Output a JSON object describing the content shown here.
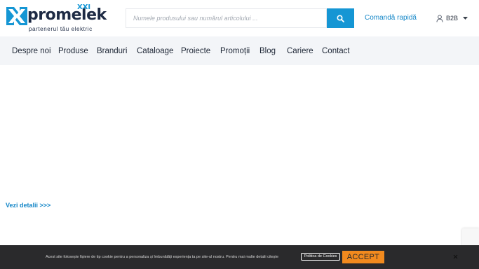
{
  "logo": {
    "name": "promelek",
    "suffix": "XXI",
    "tagline": "partenerul tău elektric"
  },
  "search": {
    "placeholder": "Numele produsului sau numărul articolului ..."
  },
  "header": {
    "quick_order": "Comandă rapidă",
    "b2b": "B2B"
  },
  "nav": {
    "items": [
      {
        "label": "Despre noi"
      },
      {
        "label": "Produse"
      },
      {
        "label": "Branduri"
      },
      {
        "label": "Cataloage"
      },
      {
        "label": "Proiecte"
      },
      {
        "label": "Promoții"
      },
      {
        "label": "Blog"
      },
      {
        "label": "Cariere"
      },
      {
        "label": "Contact"
      }
    ]
  },
  "main": {
    "details_link": "Vezi detalii >>>"
  },
  "cookie": {
    "text": "Acest site folosește fișiere de tip cookie pentru a personaliza și îmbunătăți experiența ta pe site-ul nostru. Pentru mai multe detalii citește",
    "policy_link": "Politica de Cookies",
    "accept": "ACCEPT"
  },
  "colors": {
    "brand_blue": "#1596d4",
    "navy": "#1d2a44",
    "accept_orange": "#f28a1e",
    "cookie_bg": "#2a2a2c",
    "nav_bg": "#f3f5f8"
  },
  "icons": {
    "search": "search-icon",
    "user": "user-icon",
    "caret": "caret-down-icon",
    "close": "close-icon"
  }
}
